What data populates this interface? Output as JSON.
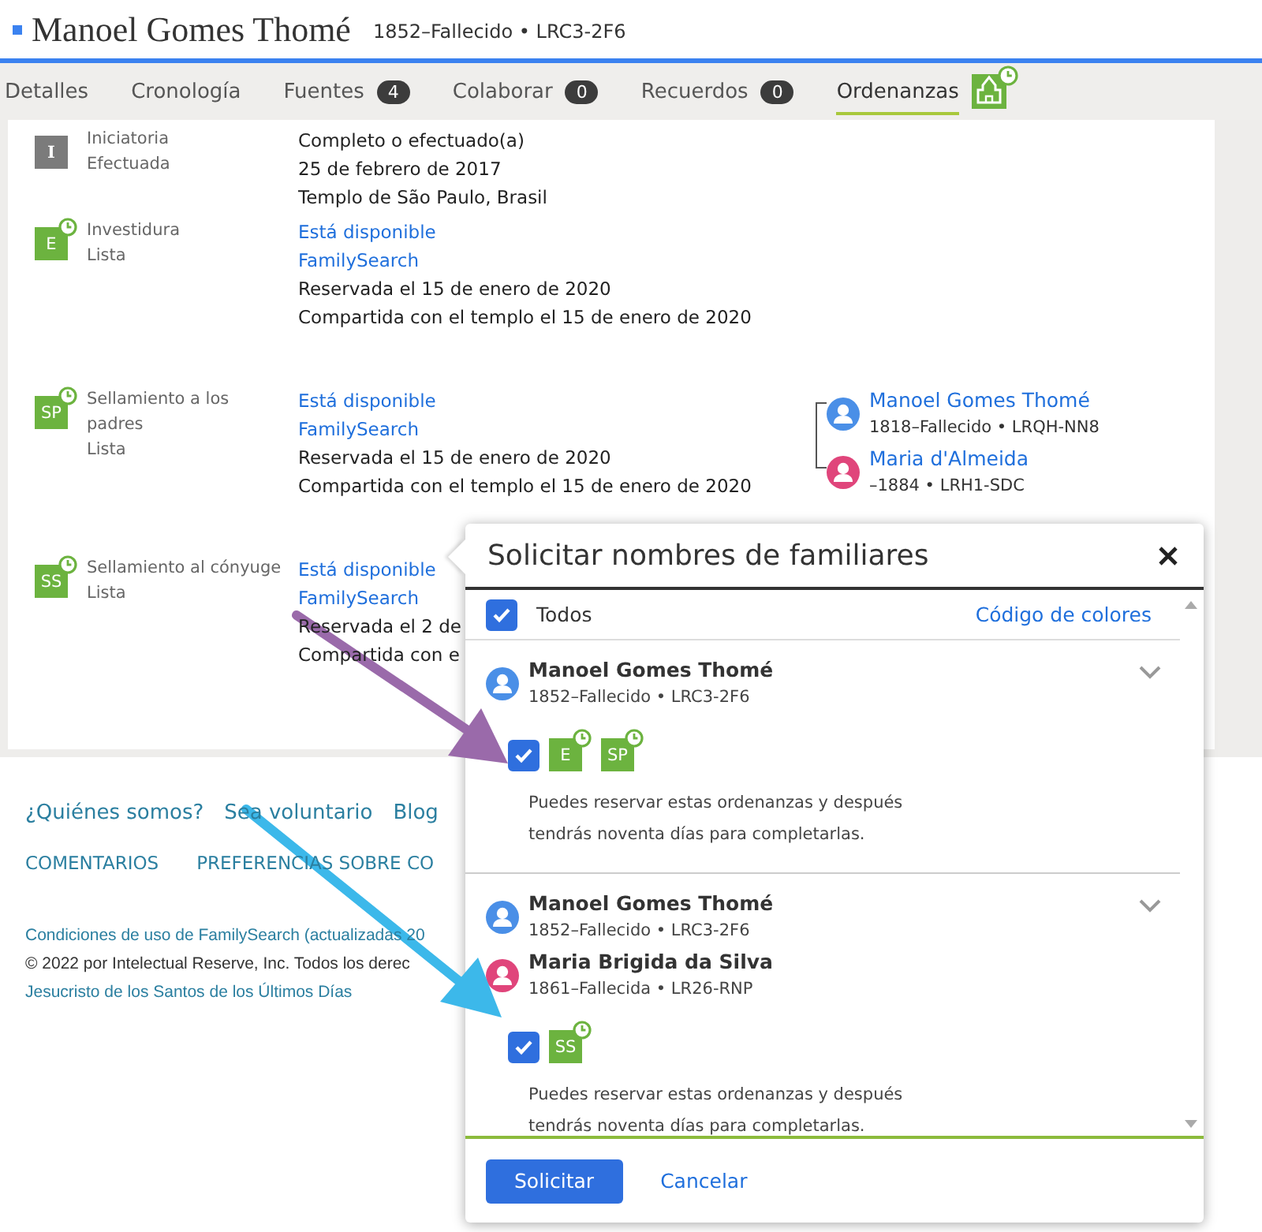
{
  "header": {
    "name": "Manoel Gomes Thomé",
    "meta": "1852–Fallecido • LRC3-2F6"
  },
  "tabs": [
    {
      "label": "Detalles",
      "selected": false,
      "kind": "plain"
    },
    {
      "label": "Cronología",
      "selected": false,
      "kind": "plain"
    },
    {
      "label": "Fuentes",
      "selected": false,
      "kind": "count",
      "count": "4"
    },
    {
      "label": "Colaborar",
      "selected": false,
      "kind": "count",
      "count": "0"
    },
    {
      "label": "Recuerdos",
      "selected": false,
      "kind": "count",
      "count": "0"
    },
    {
      "label": "Ordenanzas",
      "selected": true,
      "kind": "temple"
    }
  ],
  "ordinances": [
    {
      "code": "I",
      "reserved": false,
      "name": "Iniciatoria",
      "status": "Efectuada",
      "details": [
        {
          "kind": "text",
          "text": "Completo o efectuado(a)"
        },
        {
          "kind": "text",
          "text": "25 de febrero de 2017"
        },
        {
          "kind": "text",
          "text": "Templo de São Paulo, Brasil"
        }
      ]
    },
    {
      "code": "E",
      "reserved": true,
      "name": "Investidura",
      "status": "Lista",
      "details": [
        {
          "kind": "link",
          "text": "Está disponible"
        },
        {
          "kind": "link",
          "text": "FamilySearch"
        },
        {
          "kind": "text",
          "text": "Reservada el 15 de enero de 2020"
        },
        {
          "kind": "text",
          "text": "Compartida con el templo el 15 de enero de 2020"
        }
      ]
    },
    {
      "code": "SP",
      "reserved": true,
      "name": "Sellamiento a los padres",
      "status": "Lista",
      "details": [
        {
          "kind": "link",
          "text": "Está disponible"
        },
        {
          "kind": "link",
          "text": "FamilySearch"
        },
        {
          "kind": "text",
          "text": "Reservada el 15 de enero de 2020"
        },
        {
          "kind": "text",
          "text": "Compartida con el templo el 15 de enero de 2020"
        }
      ],
      "people": [
        {
          "kind": "male",
          "name": "Manoel Gomes Thomé",
          "meta": "1818–Fallecido • LRQH-NN8"
        },
        {
          "kind": "female",
          "name": "Maria d'Almeida",
          "meta": "–1884 • LRH1-SDC"
        }
      ]
    },
    {
      "code": "SS",
      "reserved": true,
      "name": "Sellamiento al cónyuge",
      "status": "Lista",
      "details": [
        {
          "kind": "link",
          "text": "Está disponible"
        },
        {
          "kind": "link",
          "text": "FamilySearch"
        },
        {
          "kind": "text",
          "text": "Reservada el 2 de"
        },
        {
          "kind": "text",
          "text": "Compartida con e"
        }
      ]
    }
  ],
  "footer": {
    "links": [
      "¿Quiénes somos?",
      "Sea voluntario",
      "Blog"
    ],
    "caps_links": [
      "COMENTARIOS",
      "PREFERENCIAS SOBRE CO"
    ],
    "legal": [
      {
        "kind": "link",
        "text": "Condiciones de uso de FamilySearch (actualizadas 20"
      },
      {
        "kind": "text",
        "text": "© 2022 por Intelectual Reserve, Inc. Todos los derec"
      },
      {
        "kind": "link",
        "text": "Jesucristo de los Santos de los Últimos Días"
      }
    ]
  },
  "dialog": {
    "title": "Solicitar nombres de familiares",
    "select_all": {
      "label": "Todos",
      "checked": true
    },
    "color_code": "Código de colores",
    "groups": [
      {
        "checked": true,
        "people": [
          {
            "kind": "male",
            "name": "Manoel Gomes Thomé",
            "meta": "1852–Fallecido • LRC3-2F6"
          }
        ],
        "ordinances": [
          {
            "code": "E"
          },
          {
            "code": "SP"
          }
        ],
        "note": "Puedes reservar estas ordenanzas y después tendrás noventa días para completarlas."
      },
      {
        "checked": true,
        "people": [
          {
            "kind": "male",
            "name": "Manoel Gomes Thomé",
            "meta": "1852–Fallecido • LRC3-2F6"
          },
          {
            "kind": "female",
            "name": "Maria Brigida da Silva",
            "meta": "1861–Fallecida • LR26-RNP"
          }
        ],
        "ordinances": [
          {
            "code": "SS"
          }
        ],
        "note": "Puedes reservar estas ordenanzas y después tendrás noventa días para completarlas."
      }
    ],
    "actions": [
      {
        "kind": "primary",
        "label": "Solicitar"
      },
      {
        "kind": "link",
        "label": "Cancelar"
      }
    ]
  }
}
